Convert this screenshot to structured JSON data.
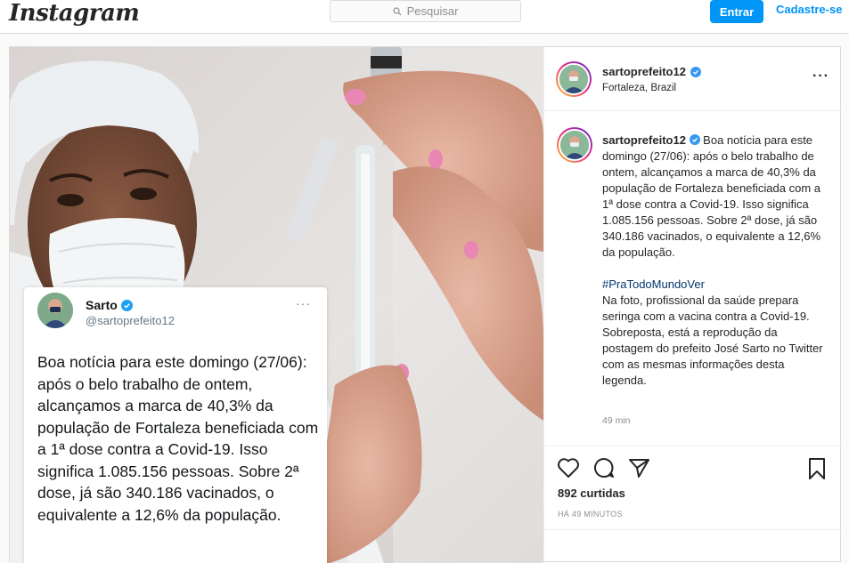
{
  "header": {
    "logo": "Instagram",
    "search_placeholder": "Pesquisar",
    "login_label": "Entrar",
    "signup_label": "Cadastre-se"
  },
  "post": {
    "username": "sartoprefeito12",
    "location": "Fortaleza, Brazil",
    "caption": {
      "username": "sartoprefeito12",
      "text": "Boa notícia para este domingo (27/06): após o belo trabalho de ontem, alcançamos a marca de 40,3% da população de Fortaleza beneficiada com a 1ª dose contra a Covid-19. Isso significa 1.085.156 pessoas. Sobre 2ª dose, já são 340.186 vacinados, o equivalente a 12,6% da população.",
      "hashtag": "#PraTodoMundoVer",
      "description": "Na foto, profissional da saúde prepara seringa com a vacina contra a Covid-19. Sobreposta, está a reprodução da postagem do prefeito José Sarto no Twitter com as mesmas informações desta legenda."
    },
    "caption_time": "49 min",
    "likes": "892 curtidas",
    "time_ago": "HÁ 49 MINUTOS"
  },
  "tweet": {
    "name": "Sarto",
    "handle": "@sartoprefeito12",
    "text": "Boa notícia para este domingo (27/06): após o belo trabalho de ontem, alcançamos a marca de 40,3% da população de Fortaleza beneficiada com a 1ª dose contra a Covid-19. Isso significa 1.085.156 pessoas. Sobre 2ª dose, já são 340.186 vacinados, o equivalente a 12,6% da população."
  },
  "colors": {
    "accent": "#0095f6",
    "verified": "#3897f0",
    "hashtag": "#00376b"
  },
  "icons": [
    "search-icon",
    "verified-icon",
    "more-icon",
    "heart-icon",
    "comment-icon",
    "share-icon",
    "bookmark-icon"
  ]
}
